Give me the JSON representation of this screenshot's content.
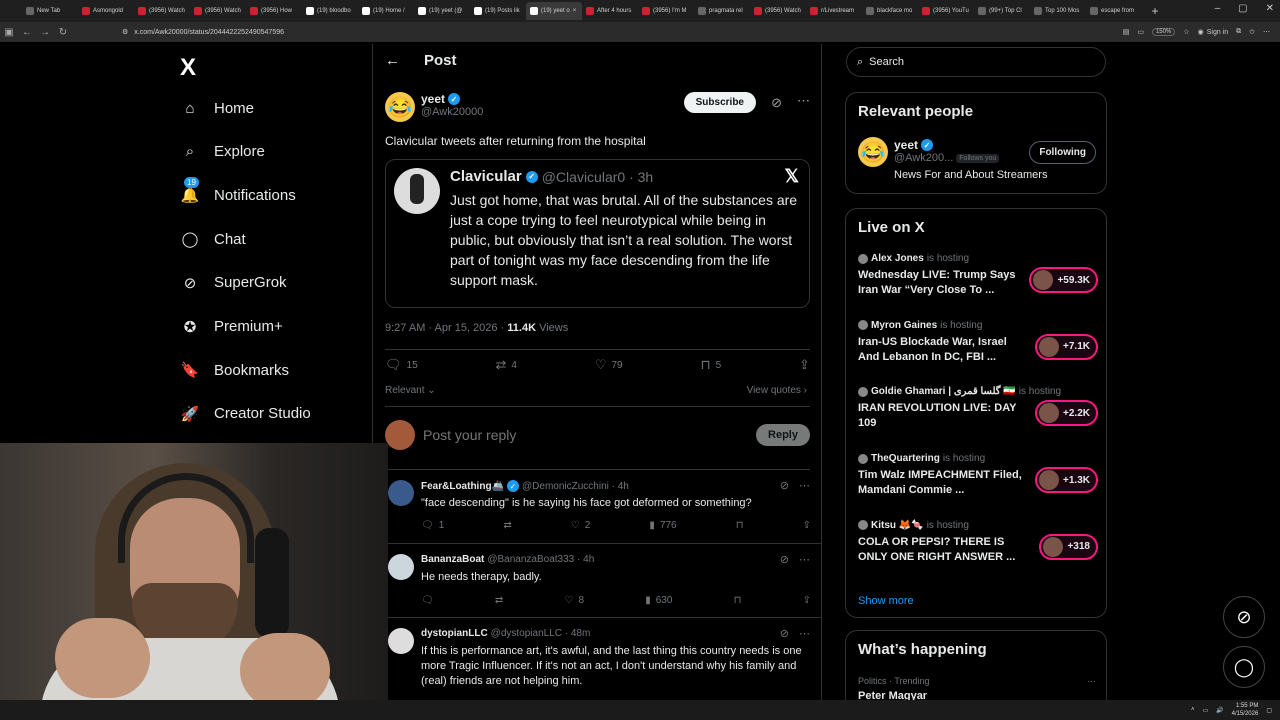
{
  "browser": {
    "tabs": [
      {
        "label": "New Tab",
        "fav": "g"
      },
      {
        "label": "Asmongold",
        "fav": "r"
      },
      {
        "label": "(3956) Watch",
        "fav": "r"
      },
      {
        "label": "(3956) Watch",
        "fav": "r"
      },
      {
        "label": "(3956) How",
        "fav": "r"
      },
      {
        "label": "(19) bloodbo",
        "fav": "x"
      },
      {
        "label": "(19) Home /",
        "fav": "x"
      },
      {
        "label": "(19) yeet (@",
        "fav": "x"
      },
      {
        "label": "(19) Posts lik",
        "fav": "x"
      },
      {
        "label": "(19) yeet o",
        "fav": "x",
        "active": true
      },
      {
        "label": "After 4 hours",
        "fav": "r"
      },
      {
        "label": "(3956) I'm M",
        "fav": "r"
      },
      {
        "label": "pragmata rel",
        "fav": "g"
      },
      {
        "label": "(3956) Watch",
        "fav": "r"
      },
      {
        "label": "r/Livestream",
        "fav": "r"
      },
      {
        "label": "blackface mo",
        "fav": "g"
      },
      {
        "label": "(3956) YouTu",
        "fav": "r"
      },
      {
        "label": "(99+) Top Cl",
        "fav": "g"
      },
      {
        "label": "Top 100 Mos",
        "fav": "g"
      },
      {
        "label": "escape from",
        "fav": "g"
      }
    ],
    "url": "x.com/Awk20000/status/2044422252490547596",
    "zoom": "150%",
    "signin": "Sign in"
  },
  "nav": {
    "logo": "X",
    "items": [
      {
        "label": "Home",
        "icon": "home-icon",
        "glyph": "⌂"
      },
      {
        "label": "Explore",
        "icon": "search-icon",
        "glyph": "⌕"
      },
      {
        "label": "Notifications",
        "icon": "bell-icon",
        "glyph": "🔔",
        "badge": "19"
      },
      {
        "label": "Chat",
        "icon": "chat-icon",
        "glyph": "◯"
      },
      {
        "label": "SuperGrok",
        "icon": "grok-icon",
        "glyph": "⊘"
      },
      {
        "label": "Premium+",
        "icon": "premium-icon",
        "glyph": "✪"
      },
      {
        "label": "Bookmarks",
        "icon": "bookmark-icon",
        "glyph": "🔖"
      },
      {
        "label": "Creator Studio",
        "icon": "rocket-icon",
        "glyph": "🚀"
      }
    ]
  },
  "post": {
    "header": "Post",
    "author_name": "yeet",
    "author_handle": "@Awk20000",
    "subscribe": "Subscribe",
    "text": "Clavicular tweets after returning from the hospital",
    "quote": {
      "name": "Clavicular",
      "handle": "@Clavicular0 · 3h",
      "text": "Just got home, that was brutal. All of the substances are just a cope trying to feel neurotypical while being in public, but obviously that isn’t a real solution. The worst part of tonight was my face descending from the life support mask."
    },
    "time": "9:27 AM · Apr 15, 2026 · ",
    "views": "11.4K",
    "views_label": " Views",
    "replies": "15",
    "reposts": "4",
    "likes": "79",
    "bookmarks": "5",
    "relevant": "Relevant",
    "view_quotes": "View quotes",
    "reply_placeholder": "Post your reply",
    "reply_button": "Reply"
  },
  "replies": [
    {
      "name": "Fear&Loathing🚢",
      "handle": "@DemonicZucchini · 4h",
      "text": "\"face descending\" is he saying his face got deformed or something?",
      "replies": "1",
      "reposts": "",
      "likes": "2",
      "views": "776"
    },
    {
      "name": "BananzaBoat",
      "handle": "@BananzaBoat333 · 4h",
      "text": "He needs therapy, badly.",
      "replies": "",
      "reposts": "",
      "likes": "8",
      "views": "630"
    },
    {
      "name": "dystopianLLC",
      "handle": "@dystopianLLC · 48m",
      "text": "If this is performance art, it's awful, and the last thing this country needs is one more Tragic Influencer. If it's not an act, I don't understand why his family and (real) friends are not helping him."
    }
  ],
  "right": {
    "search_placeholder": "Search",
    "relevant_title": "Relevant people",
    "person": {
      "name": "yeet",
      "handle": "@Awk200...",
      "follows": "Follows you",
      "button": "Following",
      "bio": "News For and About Streamers"
    },
    "live_title": "Live on X",
    "live": [
      {
        "host": "Alex Jones",
        "status": "is hosting",
        "title": "Wednesday LIVE: Trump Says Iran War “Very Close To ...",
        "count": "+59.3K"
      },
      {
        "host": "Myron Gaines",
        "status": "is hosting",
        "title": "Iran-US Blockade War, Israel And Lebanon In DC, FBI ...",
        "count": "+7.1K"
      },
      {
        "host": "Goldie Ghamari | گلسا قمری 🇮🇷",
        "status": "is hosting",
        "title": "IRAN REVOLUTION LIVE: DAY 109",
        "count": "+2.2K"
      },
      {
        "host": "TheQuartering",
        "status": "is hosting",
        "title": "Tim Walz IMPEACHMENT Filed, Mamdani Commie ...",
        "count": "+1.3K"
      },
      {
        "host": "Kitsu 🦊🍬",
        "status": "is hosting",
        "title": "COLA OR PEPSI? THERE IS ONLY ONE RIGHT ANSWER ...",
        "count": "+318"
      }
    ],
    "show_more": "Show more",
    "happening_title": "What’s happening",
    "trend_meta": "Politics · Trending",
    "trend_name": "Peter Magyar"
  },
  "taskbar": {
    "time": "1:55 PM",
    "date": "4/15/2026"
  },
  "colors": {
    "accent": "#1d9bf0",
    "live": "#f91880",
    "bg": "#000000",
    "border": "#2f3336"
  }
}
